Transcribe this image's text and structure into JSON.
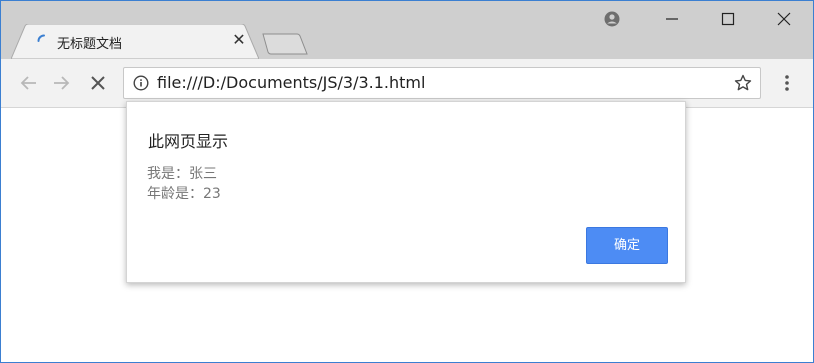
{
  "browser": {
    "tab": {
      "title": "无标题文档",
      "close_glyph": "✕",
      "spinner_icon": "loading-spinner-icon",
      "spinner_color": "#3b7fd1"
    },
    "newtab_icon": "new-tab-icon",
    "account_icon": "account-icon",
    "window_controls": [
      "minimize-icon",
      "maximize-icon",
      "close-icon"
    ],
    "toolbar": {
      "back_icon": "back-arrow-icon",
      "forward_icon": "forward-arrow-icon",
      "stop_icon": "stop-icon",
      "info_icon": "info-icon",
      "url": "file:///D:/Documents/JS/3/3.1.html",
      "star_icon": "star-icon",
      "menu_icon": "menu-icon"
    }
  },
  "dialog": {
    "title": "此网页显示",
    "lines": [
      "我是：张三",
      "年龄是：23"
    ],
    "ok_label": "确定",
    "ok_color": "#4d8cf4"
  }
}
